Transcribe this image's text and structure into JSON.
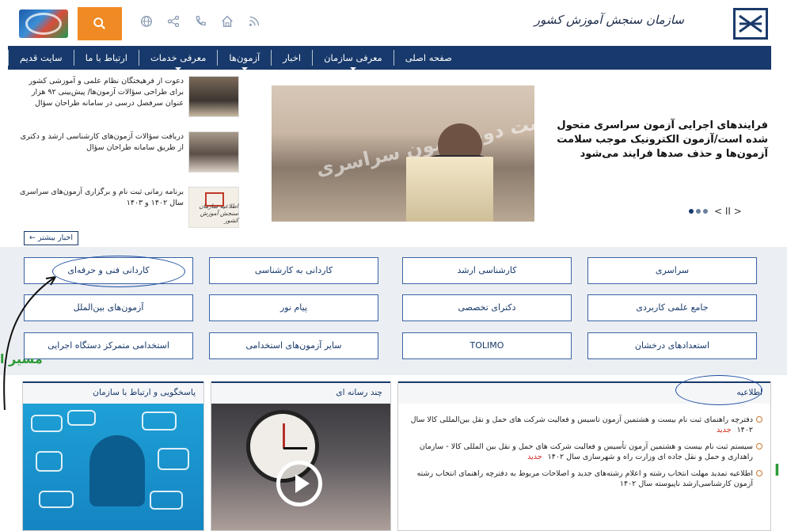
{
  "header": {
    "org_name": "سازمان سنجش آموزش کشور",
    "icons": [
      "search-icon",
      "globe-icon",
      "share-icon",
      "phone-icon",
      "home-icon",
      "rss-icon"
    ]
  },
  "nav": {
    "items": [
      {
        "label": "صفحه اصلی",
        "has_caret": false
      },
      {
        "label": "معرفی سازمان",
        "has_caret": true
      },
      {
        "label": "اخبار",
        "has_caret": false
      },
      {
        "label": "آزمون‌ها",
        "has_caret": true
      },
      {
        "label": "معرفی خدمات",
        "has_caret": true
      },
      {
        "label": "ارتباط با ما",
        "has_caret": false
      },
      {
        "label": "سایت قدیم",
        "has_caret": false
      }
    ]
  },
  "news": {
    "side": [
      {
        "text": "دعوت از فرهیختگان نظام علمی و آموزشی کشور برای طراحی سؤالات آزمون‌ها/ پیش‌بینی ۹۲ هزار عنوان سرفصل درسی در سامانه طراحان سؤال"
      },
      {
        "text": "دریافت سؤالات آزمون‌های کارشناسی ارشد و دکتری از طریق سامانه طراحان سؤال"
      },
      {
        "text": "برنامه زمانی ثبت نام و برگزاری آزمون‌های سراسری سال ۱۴۰۲ و ۱۴۰۳"
      }
    ],
    "thumb3_caption": "اطلاعیه سازمان سنجش آموزش کشور",
    "main_banner": "نشست تبیین ابعاد اجرایی نوبت دوم آزمون سراسری",
    "headline": "فرایندهای اجرایی آزمون سراسری متحول شده است/آزمون الکترونیک موجب سلامت آزمون‌ها و حذف صدها فرایند می‌شود",
    "more_label": "اخبار بیشتر ←",
    "slider_controls": "< II >"
  },
  "categories": [
    {
      "label": "سراسری"
    },
    {
      "label": "کارشناسی ارشد"
    },
    {
      "label": "کاردانی به کارشناسی"
    },
    {
      "label": "کاردانی فنی و حرفه‌ای"
    },
    {
      "label": "جامع علمی کاربردی"
    },
    {
      "label": "دکترای تخصصی"
    },
    {
      "label": "پیام نور"
    },
    {
      "label": "آزمون‌های بین‌الملل"
    },
    {
      "label": "استعدادهای درخشان"
    },
    {
      "label": "TOLIMO"
    },
    {
      "label": "سایر آزمون‌های استخدامی"
    },
    {
      "label": "استخدامی متمرکز دستگاه اجرایی"
    }
  ],
  "annotations": {
    "path_label": "مسیر ا",
    "right_edge_mark": "ا"
  },
  "cards": {
    "contact": {
      "title": "پاسخگویی و ارتباط با سازمان"
    },
    "media": {
      "title": "چند رسانه ای"
    },
    "announce": {
      "title": "اطلاعیه",
      "items": [
        {
          "text": "دفترچه راهنمای ثبت نام بیست و هشتمین آزمون تاسیس و فعالیت شرکت های حمل و نقل بین‌المللی کالا سال ۱۴۰۲",
          "badge": "جدید"
        },
        {
          "text": "سیستم ثبت نام بیست و هشتمین آزمون تأسیس و فعالیت شرکت های حمل و نقل بین المللی کالا - سازمان راهداری و حمل و نقل جاده ای وزارت راه و شهرسازی سال ۱۴۰۲",
          "badge": "جدید"
        },
        {
          "text": "اطلاعیه تمدید مهلت انتخاب رشته و اعلام رشته‌های جدید و اصلاحات مربوط به دفترچه راهنمای انتخاب رشته آزمون کارشناسی‌ارشد ناپیوسته سال ۱۴۰۲",
          "badge": ""
        }
      ]
    }
  },
  "colors": {
    "navy": "#17396b",
    "orange": "#f08a24",
    "new_badge": "#d42a1f",
    "annotation_blue": "#1f4fa0",
    "annotation_green": "#2c9a38"
  }
}
